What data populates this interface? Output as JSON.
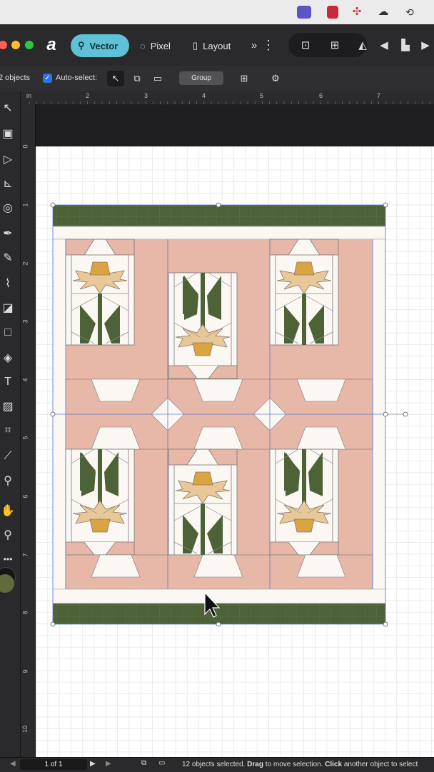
{
  "menubar": {
    "icons": [
      "display-menu-icon",
      "film-strip-icon",
      "dropbox-icon",
      "creative-cloud-icon",
      "time-machine-icon"
    ]
  },
  "toolbar": {
    "app_logo": "affinity-logo-icon",
    "personas": [
      {
        "label": "Vector",
        "icon": "vector-persona-icon",
        "active": true
      },
      {
        "label": "Pixel",
        "icon": "pixel-persona-icon",
        "active": false
      },
      {
        "label": "Layout",
        "icon": "layout-persona-icon",
        "active": false
      }
    ],
    "more_glyph": "»"
  },
  "contextbar": {
    "selection_count": "2 objects",
    "auto_select_label": "Auto-select:",
    "auto_select_checked": true,
    "group_label": "Group"
  },
  "rulers": {
    "unit": "in",
    "top_labels": [
      "2",
      "3",
      "4",
      "5",
      "6",
      "7"
    ],
    "left_labels": [
      "0",
      "1",
      "2",
      "3",
      "4",
      "5",
      "6",
      "7",
      "8",
      "9",
      "10"
    ]
  },
  "statusbar": {
    "page_indicator": "1 of 1",
    "status_selected": "12 objects selected.",
    "status_drag": "Drag",
    "status_move": "to move selection.",
    "status_click": "Click",
    "status_another": "another object to select"
  },
  "colors": {
    "green": "#4d6236",
    "pink": "#e7b7a8",
    "cream": "#fbf7f2",
    "tan": "#e8c898",
    "gold": "#d9a441",
    "accent": "#5fc1d6"
  }
}
